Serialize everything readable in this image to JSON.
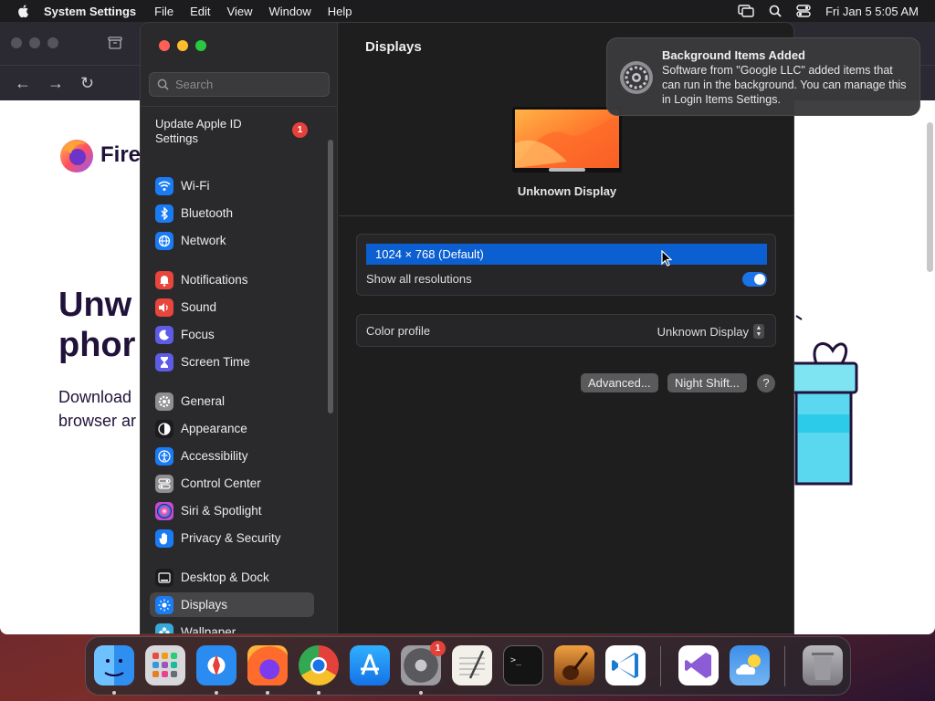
{
  "menubar": {
    "app_name": "System Settings",
    "menus": [
      "File",
      "Edit",
      "View",
      "Window",
      "Help"
    ],
    "clock": "Fri Jan 5  5:05 AM"
  },
  "firefox": {
    "logo_text": "Fire",
    "headline_line1": "Unw",
    "headline_line2": "phor",
    "subtext_line1": "Download",
    "subtext_line2": "browser ar"
  },
  "settings": {
    "search_placeholder": "Search",
    "apple_id_label": "Update Apple ID Settings",
    "apple_id_badge": "1",
    "sidebar": [
      {
        "label": "Wi-Fi",
        "icon": "wifi-icon",
        "color": "#1a7cf5"
      },
      {
        "label": "Bluetooth",
        "icon": "bluetooth-icon",
        "color": "#1a7cf5"
      },
      {
        "label": "Network",
        "icon": "globe-icon",
        "color": "#1a7cf5"
      },
      {
        "label": "Notifications",
        "icon": "bell-icon",
        "color": "#e8453c"
      },
      {
        "label": "Sound",
        "icon": "speaker-icon",
        "color": "#e8453c"
      },
      {
        "label": "Focus",
        "icon": "moon-icon",
        "color": "#5e5ce6"
      },
      {
        "label": "Screen Time",
        "icon": "hourglass-icon",
        "color": "#5e5ce6"
      },
      {
        "label": "General",
        "icon": "gear-icon",
        "color": "#8e8e93"
      },
      {
        "label": "Appearance",
        "icon": "appearance-icon",
        "color": "#1c1c1e"
      },
      {
        "label": "Accessibility",
        "icon": "accessibility-icon",
        "color": "#1a7cf5"
      },
      {
        "label": "Control Center",
        "icon": "control-center-icon",
        "color": "#8e8e93"
      },
      {
        "label": "Siri & Spotlight",
        "icon": "siri-icon",
        "color": "#c34bd8"
      },
      {
        "label": "Privacy & Security",
        "icon": "hand-icon",
        "color": "#1a7cf5"
      },
      {
        "label": "Desktop & Dock",
        "icon": "dock-icon",
        "color": "#1c1c1e"
      },
      {
        "label": "Displays",
        "icon": "sun-icon",
        "color": "#1a7cf5"
      },
      {
        "label": "Wallpaper",
        "icon": "flower-icon",
        "color": "#36a9d8"
      }
    ],
    "active_item": "Displays",
    "main": {
      "title": "Displays",
      "display_name": "Unknown Display",
      "resolution": "1024 × 768 (Default)",
      "show_all_label": "Show all resolutions",
      "show_all_on": true,
      "color_profile_label": "Color profile",
      "color_profile_value": "Unknown Display",
      "advanced_label": "Advanced...",
      "night_shift_label": "Night Shift...",
      "help_label": "?"
    }
  },
  "notification": {
    "title": "Background Items Added",
    "body": "Software from \"Google LLC\" added items that can run in the background. You can manage this in Login Items Settings."
  },
  "dock": {
    "apps": [
      "Finder",
      "Launchpad",
      "Safari",
      "Firefox",
      "Chrome",
      "App Store",
      "System Settings",
      "TextEdit",
      "Terminal",
      "GarageBand",
      "VS Code",
      "Visual Studio",
      "Weather",
      "Trash"
    ],
    "system_settings_badge": "1"
  }
}
